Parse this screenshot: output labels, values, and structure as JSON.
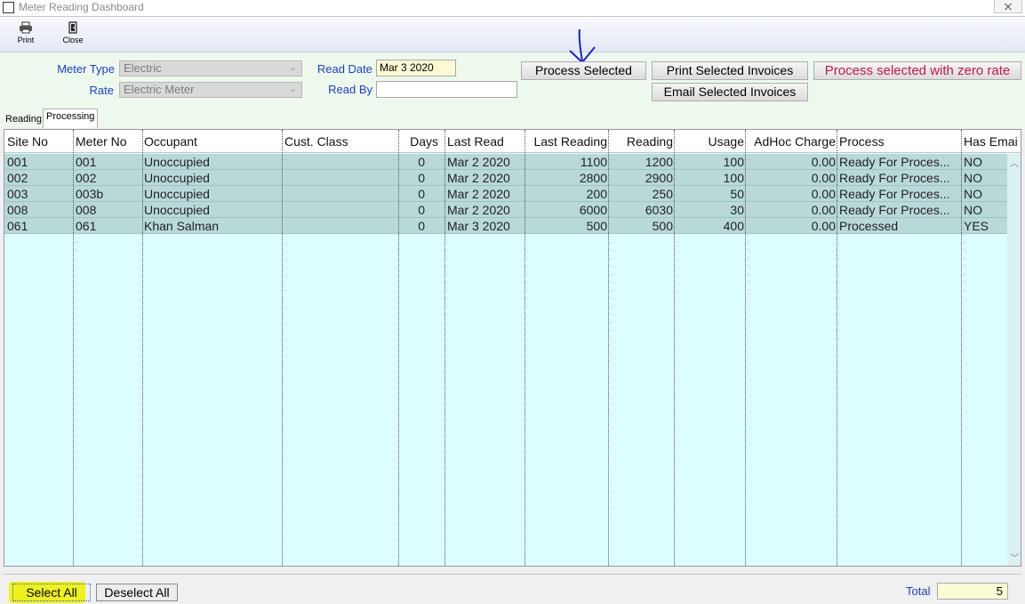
{
  "window": {
    "title": "Meter Reading Dashboard",
    "close_glyph": "⨯"
  },
  "toolbar": {
    "print": {
      "label": "Print",
      "icon": "printer-icon"
    },
    "close": {
      "label": "Close",
      "icon": "door-exit-icon"
    }
  },
  "filters": {
    "meter_type": {
      "label": "Meter Type",
      "value": "Electric"
    },
    "rate": {
      "label": "Rate",
      "value": "Electric Meter"
    },
    "read_date": {
      "label": "Read Date",
      "value": "Mar 3 2020"
    },
    "read_by": {
      "label": "Read By",
      "value": ""
    }
  },
  "actions": {
    "process_selected": "Process Selected",
    "print_selected_invoices": "Print Selected Invoices",
    "email_selected_invoices": "Email Selected Invoices",
    "process_zero_rate": "Process selected with zero rate"
  },
  "tabs": [
    {
      "label": "Reading",
      "active": false
    },
    {
      "label": "Processing",
      "active": true
    }
  ],
  "grid": {
    "columns": [
      "Site No",
      "Meter No",
      "Occupant",
      "Cust. Class",
      "Days",
      "Last Read",
      "Last Reading",
      "Reading",
      "Usage",
      "AdHoc Charge",
      "Process",
      "Has Emai"
    ],
    "rows": [
      {
        "site_no": "001",
        "meter_no": "001",
        "occupant": "Unoccupied",
        "cust_class": "",
        "days": "0",
        "last_read": "Mar 2 2020",
        "last_reading": "1100",
        "reading": "1200",
        "usage": "100",
        "adhoc_charge": "0.00",
        "process": "Ready For Proces...",
        "has_email": "NO"
      },
      {
        "site_no": "002",
        "meter_no": "002",
        "occupant": "Unoccupied",
        "cust_class": "",
        "days": "0",
        "last_read": "Mar 2 2020",
        "last_reading": "2800",
        "reading": "2900",
        "usage": "100",
        "adhoc_charge": "0.00",
        "process": "Ready For Proces...",
        "has_email": "NO"
      },
      {
        "site_no": "003",
        "meter_no": "003b",
        "occupant": "Unoccupied",
        "cust_class": "",
        "days": "0",
        "last_read": "Mar 2 2020",
        "last_reading": "200",
        "reading": "250",
        "usage": "50",
        "adhoc_charge": "0.00",
        "process": "Ready For Proces...",
        "has_email": "NO"
      },
      {
        "site_no": "008",
        "meter_no": "008",
        "occupant": "Unoccupied",
        "cust_class": "",
        "days": "0",
        "last_read": "Mar 2 2020",
        "last_reading": "6000",
        "reading": "6030",
        "usage": "30",
        "adhoc_charge": "0.00",
        "process": "Ready For Proces...",
        "has_email": "NO"
      },
      {
        "site_no": "061",
        "meter_no": "061",
        "occupant": "Khan Salman",
        "cust_class": "",
        "days": "0",
        "last_read": "Mar 3 2020",
        "last_reading": "500",
        "reading": "500",
        "usage": "400",
        "adhoc_charge": "0.00",
        "process": "Processed",
        "has_email": "YES"
      }
    ]
  },
  "footer": {
    "select_all": "Select All",
    "deselect_all": "Deselect All",
    "total_label": "Total",
    "total_value": "5"
  },
  "colors": {
    "grid_background": "#dcfeff",
    "row_selected": "#b9d9d9",
    "filter_panel": "#eef9ee",
    "label_blue": "#1c3ec8",
    "zero_rate_red": "#c8174a",
    "highlight_yellow": "#f0f11a",
    "annotation_arrow": "#1a22c8"
  }
}
